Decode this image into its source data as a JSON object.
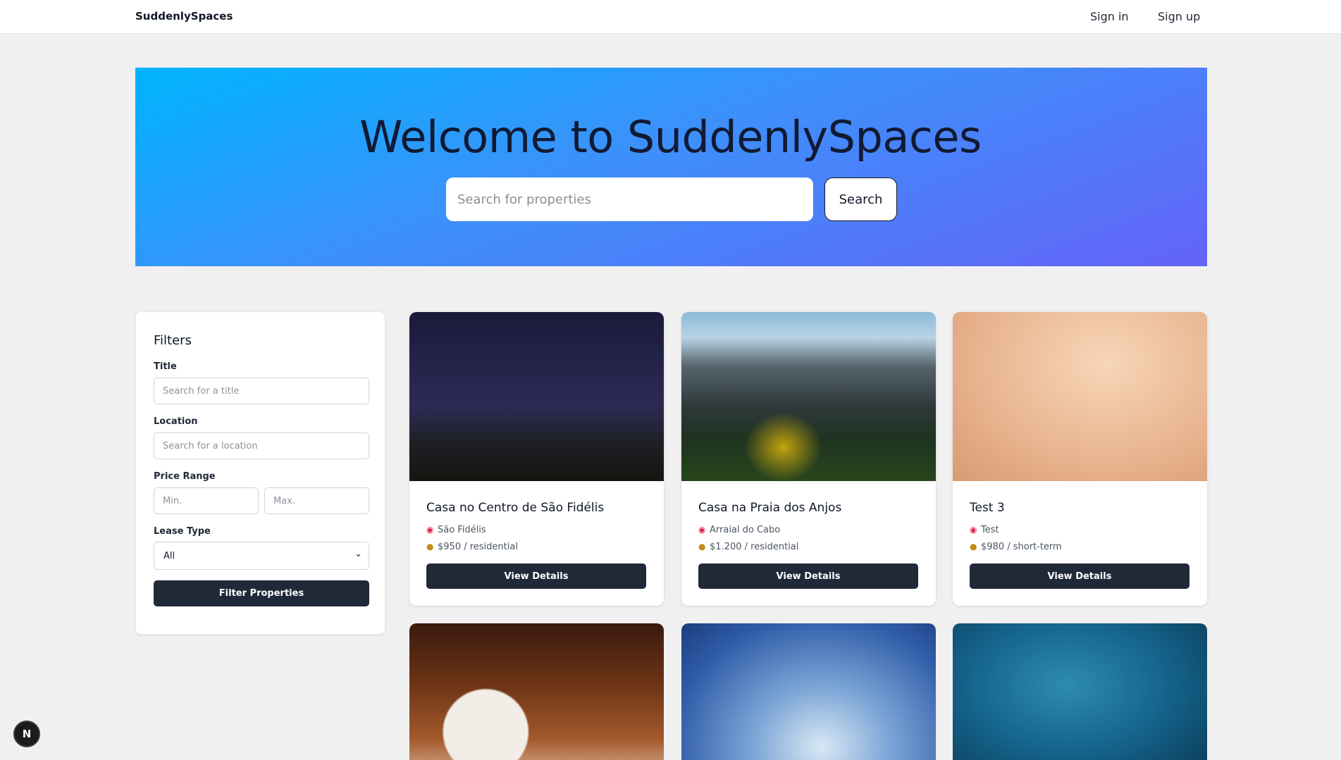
{
  "nav": {
    "brand": "SuddenlySpaces",
    "signin": "Sign in",
    "signup": "Sign up"
  },
  "hero": {
    "title": "Welcome to SuddenlySpaces",
    "search_placeholder": "Search for properties",
    "search_button": "Search"
  },
  "filters": {
    "title": "Filters",
    "title_label": "Title",
    "title_placeholder": "Search for a title",
    "location_label": "Location",
    "location_placeholder": "Search for a location",
    "price_label": "Price Range",
    "min_placeholder": "Min.",
    "max_placeholder": "Max.",
    "lease_label": "Lease Type",
    "lease_value": "All",
    "button": "Filter Properties"
  },
  "cards": [
    {
      "title": "Casa no Centro de São Fidélis",
      "location": "São Fidélis",
      "price": "$950 / residential",
      "button": "View Details"
    },
    {
      "title": "Casa na Praia dos Anjos",
      "location": "Arraial do Cabo",
      "price": "$1.200 / residential",
      "button": "View Details"
    },
    {
      "title": "Test 3",
      "location": "Test",
      "price": "$980 / short-term",
      "button": "View Details"
    }
  ],
  "icons": {
    "location": "map-pin-icon",
    "price": "money-bag-icon"
  },
  "badge": {
    "label": "N"
  }
}
